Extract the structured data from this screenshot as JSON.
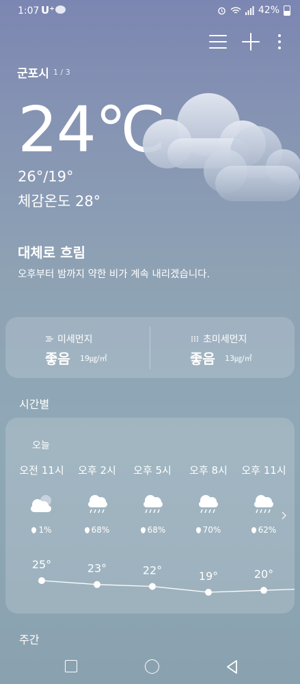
{
  "status_bar": {
    "time": "1:07",
    "carrier": "U⁺",
    "battery": "42%"
  },
  "header": {
    "city": "군포시",
    "page_indicator": "1 / 3"
  },
  "current": {
    "temperature": "24℃",
    "hi_lo": "26°/19°",
    "feels_like": "체감온도 28°",
    "condition": "대체로 흐림",
    "description": "오후부터 밤까지 약한 비가 계속 내리겠습니다."
  },
  "air_quality": [
    {
      "label": "미세먼지",
      "value": "좋음",
      "amount": "19㎍/㎥",
      "icon": "fine-dust-icon"
    },
    {
      "label": "초미세먼지",
      "value": "좋음",
      "amount": "13㎍/㎥",
      "icon": "ultrafine-dust-icon"
    }
  ],
  "hourly": {
    "section_title": "시간별",
    "day_label": "오늘",
    "items": [
      {
        "time": "오전 11시",
        "icon": "partly-cloudy-icon",
        "precip": "1%",
        "temp": "25°",
        "temp_value": 25
      },
      {
        "time": "오후 2시",
        "icon": "rain-cloud-icon",
        "precip": "68%",
        "temp": "23°",
        "temp_value": 23
      },
      {
        "time": "오후 5시",
        "icon": "rain-cloud-icon",
        "precip": "68%",
        "temp": "22°",
        "temp_value": 22
      },
      {
        "time": "오후 8시",
        "icon": "rain-cloud-icon",
        "precip": "70%",
        "temp": "19°",
        "temp_value": 19
      },
      {
        "time": "오후 11시",
        "icon": "rain-cloud-icon",
        "precip": "62%",
        "temp": "20°",
        "temp_value": 20
      }
    ]
  },
  "weekly": {
    "section_title": "주간"
  }
}
